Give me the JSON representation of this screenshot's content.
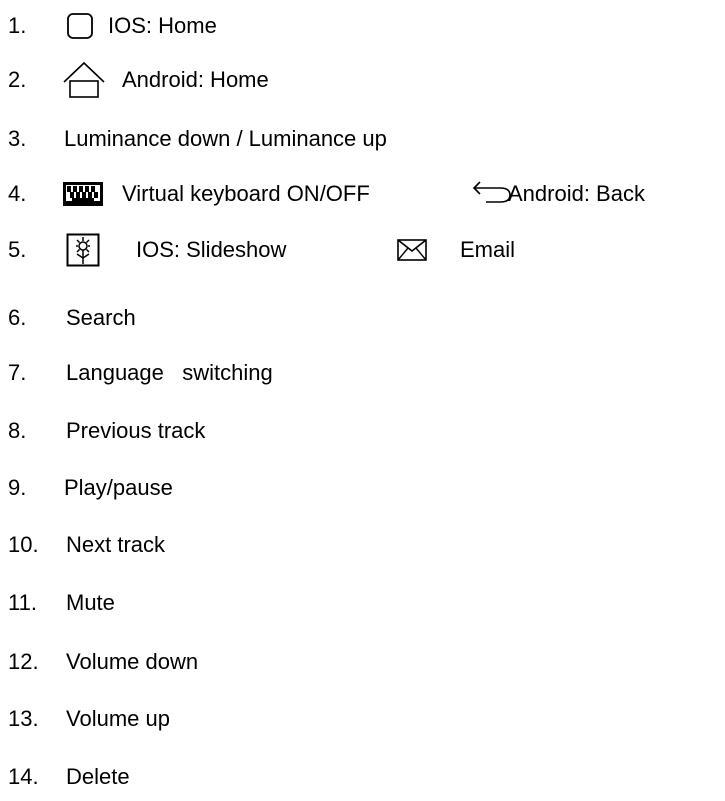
{
  "items": [
    {
      "number": "1.",
      "text": "IOS: Home",
      "icon": "rounded-square-icon"
    },
    {
      "number": "2.",
      "text": "Android: Home",
      "icon": "house-outline-icon"
    },
    {
      "number": "3.",
      "text": "Luminance down / Luminance up"
    },
    {
      "number": "4.",
      "text": "Virtual keyboard ON/OFF",
      "icon": "keyboard-icon",
      "extra_text": "Android: Back",
      "extra_icon": "back-arrow-icon"
    },
    {
      "number": "5.",
      "text": "IOS: Slideshow",
      "icon": "flower-picture-icon",
      "extra_text": "Email",
      "extra_icon": "envelope-icon"
    },
    {
      "number": "6.",
      "text": "Search"
    },
    {
      "number": "7.",
      "text": "Language   switching"
    },
    {
      "number": "8.",
      "text": "Previous track"
    },
    {
      "number": "9.",
      "text": "Play/pause"
    },
    {
      "number": "10.",
      "text": "Next track"
    },
    {
      "number": "11.",
      "text": "Mute"
    },
    {
      "number": "12.",
      "text": "Volume down"
    },
    {
      "number": "13.",
      "text": "Volume up"
    },
    {
      "number": "14.",
      "text": "Delete"
    }
  ]
}
